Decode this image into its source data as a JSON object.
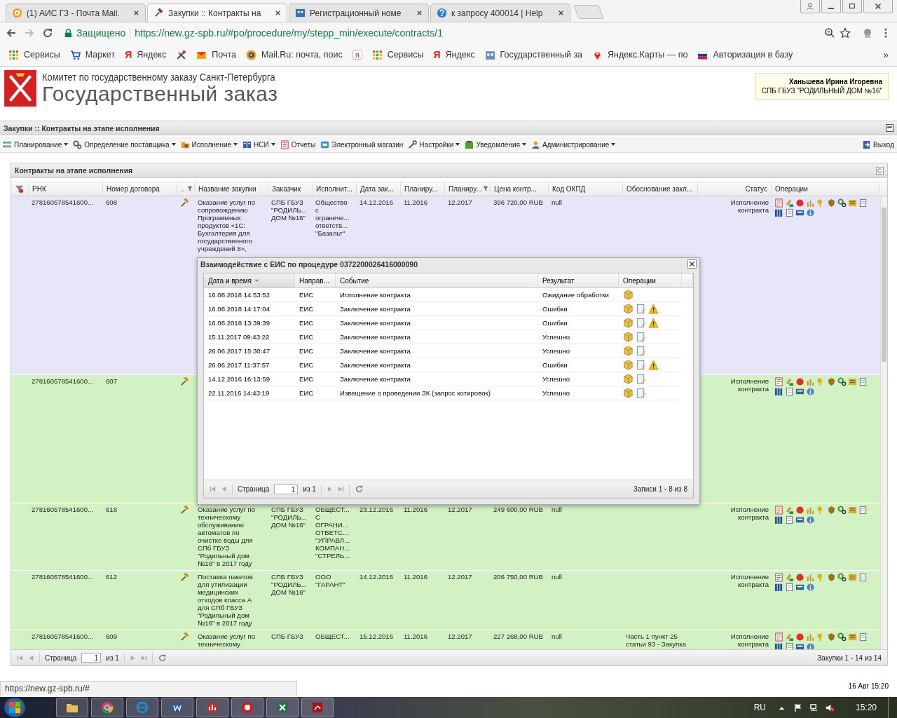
{
  "browser": {
    "tabs": [
      {
        "title": "(1) АИС ГЗ - Почта Mail.",
        "selected": false
      },
      {
        "title": "Закупки :: Контракты на",
        "selected": true
      },
      {
        "title": "Регистрационный номе",
        "selected": false
      },
      {
        "title": "к запросу 400014 | Help",
        "selected": false
      }
    ],
    "secure_label": "Защищено",
    "url": "https://new.gz-spb.ru/#po/procedure/my/stepp_min/execute/contracts/1",
    "bookmarks": [
      {
        "label": "Сервисы"
      },
      {
        "label": "Маркет"
      },
      {
        "label": "Яндекс",
        "glyph": "Я"
      },
      {
        "label": "Почта"
      },
      {
        "label": "Mail.Ru: почта, поис"
      },
      {
        "glyph": "я"
      },
      {
        "label": "Сервисы"
      },
      {
        "label": "Яндекс",
        "glyph": "Я"
      },
      {
        "label": "Государственный за"
      },
      {
        "label": "Яндекс.Карты — по"
      },
      {
        "label": "Авторизация в базу"
      }
    ],
    "more": "»",
    "status_url": "https://new.gz-spb.ru/#"
  },
  "header": {
    "org": "Комитет по государственному заказу Санкт-Петербурга",
    "title": "Государственный заказ",
    "user_name": "Ханьшева Ирина Игоревна",
    "user_org": "СПБ ГБУЗ \"РОДИЛЬНЫЙ ДОМ №16\""
  },
  "page_title": "Закупки :: Контракты на этапе исполнения",
  "menu": [
    {
      "label": "Планирование",
      "dropdown": true
    },
    {
      "label": "Определение поставщика",
      "dropdown": true
    },
    {
      "label": "Исполнение",
      "dropdown": true
    },
    {
      "label": "НСИ",
      "dropdown": true
    },
    {
      "label": "Отчеты",
      "dropdown": false
    },
    {
      "label": "Электронный магазин",
      "dropdown": false
    },
    {
      "label": "Настройки",
      "dropdown": true
    },
    {
      "label": "Уведомления",
      "dropdown": true
    },
    {
      "label": "Администрирование",
      "dropdown": true
    }
  ],
  "logout": "Выход",
  "grid": {
    "title": "Контракты на этапе исполнения",
    "columns": [
      {
        "label": "РНК",
        "filtered": false
      },
      {
        "label": "Номер договора",
        "filtered": false
      },
      {
        "label": "..",
        "filtered": true
      },
      {
        "label": "Название закупки",
        "filtered": false
      },
      {
        "label": "Заказчик",
        "filtered": false
      },
      {
        "label": "Исполнит...",
        "filtered": false
      },
      {
        "label": "Дата зак...",
        "filtered": false
      },
      {
        "label": "Планиру...",
        "filtered": false
      },
      {
        "label": "Планиру...",
        "filtered": true
      },
      {
        "label": "Цена контр...",
        "filtered": false
      },
      {
        "label": "Код ОКПД",
        "filtered": false
      },
      {
        "label": "Обоснование закл...",
        "filtered": false
      },
      {
        "label": "Статус",
        "filtered": false
      },
      {
        "label": "Операции",
        "filtered": false
      }
    ],
    "rows": [
      {
        "rnk": "278160578541600...",
        "number": "608",
        "name": "Оказание услуг по\nсопровождению\nПрограммных\nпродуктов «1С:\nБухгалтерия для\nгосударственного\nучреждений 8»,",
        "customer": "СПБ ГБУЗ\n\"РОДИЛЬ...\nДОМ №16\"",
        "supplier": "Общество\nс\nограниче...\nответств...\n\"Базальт\"",
        "date": "14.12.2016",
        "plan_start": "11.2016",
        "plan_end": "12.2017",
        "price": "396 720,00 RUB",
        "okpd": "null",
        "status": "Исполнение\nконтракта",
        "selected": true
      },
      {
        "rnk": "278160578541600...",
        "number": "607",
        "status": "Исполнение\nконтракта",
        "selected": false
      },
      {
        "rnk": "278160578541600...",
        "number": "618",
        "name": "Оказание услуг по\nтехническому\nобслуживанию\nавтоматов по\nочистке воды для\nСПб ГБУЗ\n\"Родильный дом\n№16\" в 2017 году",
        "customer": "СПБ ГБУЗ\n\"РОДИЛЬ...\nДОМ №16\"",
        "supplier": "ОБЩЕСТ...\nС\nОГРАНИ...\nОТВЕТС...\n\"УПРАВЛ...\nКОМПАН...\n\"СТРЕЛЬ...",
        "date": "23.12.2016",
        "plan_start": "11.2016",
        "plan_end": "12.2017",
        "price": "249 600,00 RUB",
        "okpd": "null",
        "status": "Исполнение\nконтракта",
        "selected": false
      },
      {
        "rnk": "278160578541600...",
        "number": "612",
        "name": "Поставка пакетов\nдля утилизации\nмедицинских\nотходов класса А\nдля СПб ГБУЗ\n\"Родильный дом\n№16\" в 2017 году",
        "customer": "СПБ ГБУЗ\n\"РОДИЛЬ...\nДОМ №16\"",
        "supplier": "ООО\n\"ГАРАНТ\"",
        "date": "14.12.2016",
        "plan_start": "11.2016",
        "plan_end": "12.2017",
        "price": "206 750,00 RUB",
        "okpd": "null",
        "status": "Исполнение\nконтракта",
        "selected": false
      },
      {
        "rnk": "278160578541600...",
        "number": "609",
        "name": "Оказание услуг по\nтехническому",
        "customer": "СПБ ГБУЗ",
        "supplier": "ОБЩЕСТ...",
        "date": "15.12.2016",
        "plan_start": "11.2016",
        "plan_end": "12.2017",
        "price": "227 268,00 RUB",
        "okpd": "null",
        "basis": "Часть 1 пункт 25\nстатьи 93 - Закупка",
        "status": "Исполнение\nконтракта",
        "selected": false
      }
    ],
    "page_label": "Страница",
    "page": "1",
    "page_of": "из 1",
    "summary": "Закупки 1 - 14 из 14"
  },
  "dialog": {
    "title": "Взаимодействие с ЕИС по процедуре 0372200026416000090",
    "columns": [
      {
        "label": "Дата и время",
        "sorted": true
      },
      {
        "label": "Направ...",
        "sorted": false
      },
      {
        "label": "Событие",
        "sorted": false
      },
      {
        "label": "Результат",
        "sorted": false
      },
      {
        "label": "Операции",
        "sorted": false
      }
    ],
    "rows": [
      {
        "datetime": "16.08.2018 14:53:52",
        "direction": "ЕИС",
        "event": "Исполнение контракта",
        "result": "Ожидание обработки",
        "document": false,
        "warning": false
      },
      {
        "datetime": "16.08.2018 14:17:04",
        "direction": "ЕИС",
        "event": "Заключение контракта",
        "result": "Ошибки",
        "document": true,
        "warning": true
      },
      {
        "datetime": "16.08.2018 13:39:39",
        "direction": "ЕИС",
        "event": "Заключение контракта",
        "result": "Ошибки",
        "document": true,
        "warning": true
      },
      {
        "datetime": "15.11.2017 09:43:22",
        "direction": "ЕИС",
        "event": "Заключение контракта",
        "result": "Успешно",
        "document": true,
        "warning": false
      },
      {
        "datetime": "26.06.2017 15:30:47",
        "direction": "ЕИС",
        "event": "Заключение контракта",
        "result": "Успешно",
        "document": true,
        "warning": false
      },
      {
        "datetime": "26.06.2017 11:37:57",
        "direction": "ЕИС",
        "event": "Заключение контракта",
        "result": "Ошибки",
        "document": true,
        "warning": true
      },
      {
        "datetime": "14.12.2016 16:13:59",
        "direction": "ЕИС",
        "event": "Заключение контракта",
        "result": "Успешно",
        "document": true,
        "warning": false
      },
      {
        "datetime": "22.11.2016 14:43:19",
        "direction": "ЕИС",
        "event": "Извещение о проведении ЗК (запрос котировок)",
        "result": "Успешно",
        "document": true,
        "warning": false
      }
    ],
    "page_label": "Страница",
    "page": "1",
    "page_of": "из 1",
    "summary": "Записи 1 - 8 из 8"
  },
  "clock_note": "16 Авг 15:20",
  "taskbar": {
    "lang": "RU",
    "time": "15:20"
  }
}
